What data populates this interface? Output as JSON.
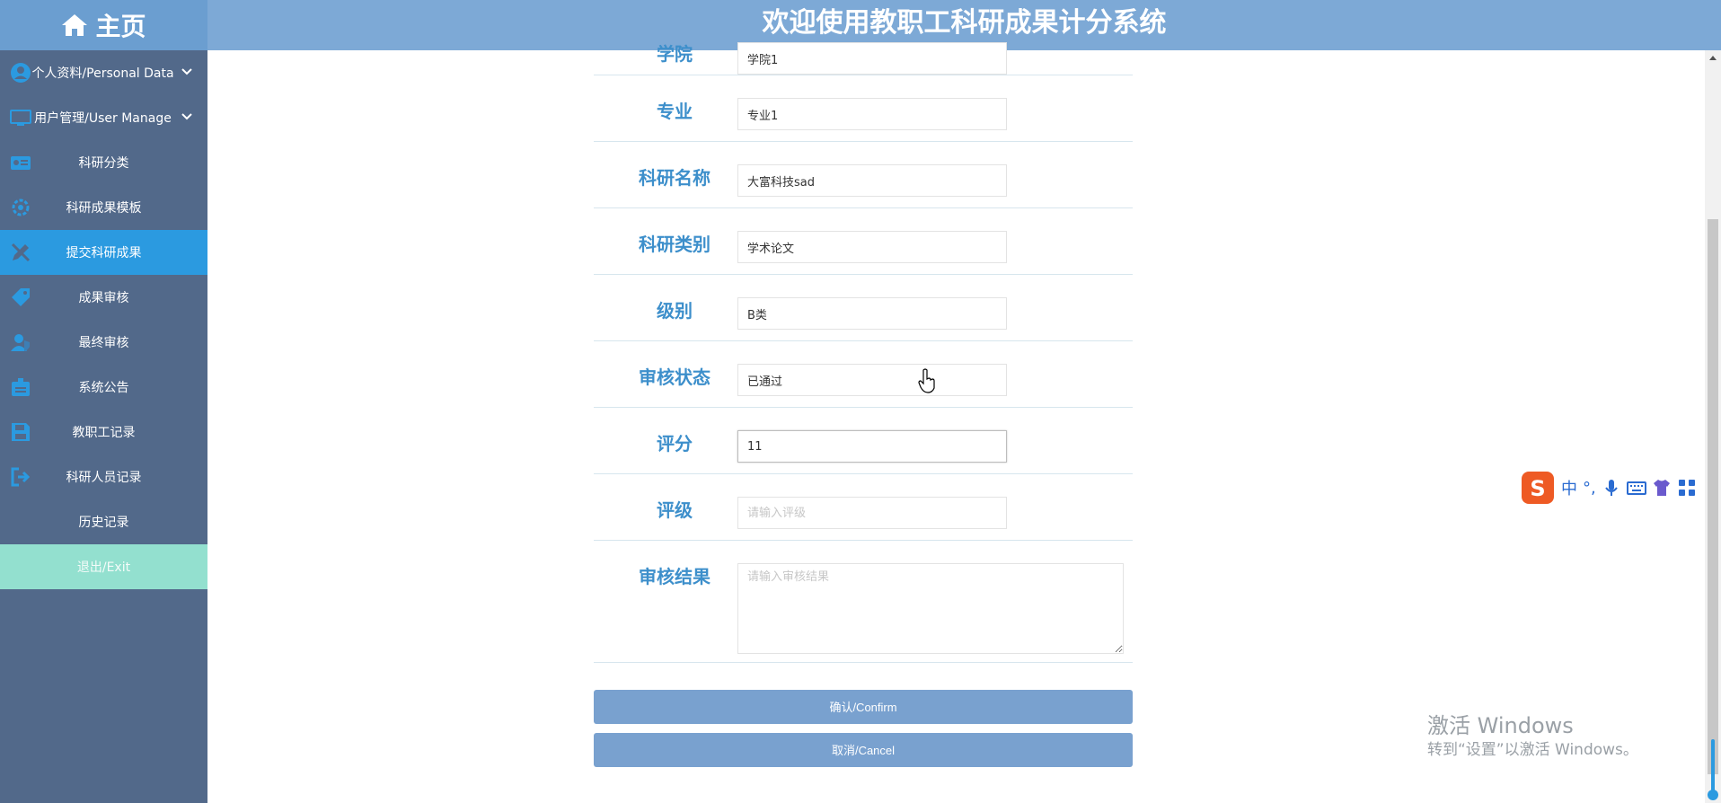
{
  "header": {
    "home_label": "主页",
    "title": "欢迎使用教职工科研成果计分系统"
  },
  "sidebar": {
    "items": [
      {
        "label": "个人资料/Personal Data",
        "icon": "user-circle-icon",
        "expandable": true
      },
      {
        "label": "用户管理/User Manage",
        "icon": "monitor-icon",
        "expandable": true
      },
      {
        "label": "科研分类",
        "icon": "id-card-icon"
      },
      {
        "label": "科研成果模板",
        "icon": "gear-icon"
      },
      {
        "label": "提交科研成果",
        "icon": "pencil-ruler-icon",
        "active": true
      },
      {
        "label": "成果审核",
        "icon": "tags-icon"
      },
      {
        "label": "最终审核",
        "icon": "user-shield-icon"
      },
      {
        "label": "系统公告",
        "icon": "id-badge-icon"
      },
      {
        "label": "教职工记录",
        "icon": "save-icon"
      },
      {
        "label": "科研人员记录",
        "icon": "sign-out-icon"
      },
      {
        "label": "历史记录",
        "icon": ""
      },
      {
        "label": "退出/Exit",
        "icon": ""
      }
    ]
  },
  "form": {
    "fields": [
      {
        "label": "学院",
        "value": "学院1"
      },
      {
        "label": "专业",
        "value": "专业1"
      },
      {
        "label": "科研名称",
        "value": "大富科技sad"
      },
      {
        "label": "科研类别",
        "value": "学术论文"
      },
      {
        "label": "级别",
        "value": "B类"
      },
      {
        "label": "审核状态",
        "value": "已通过"
      },
      {
        "label": "评分",
        "value": "11"
      },
      {
        "label": "评级",
        "value": "",
        "placeholder": "请输入评级"
      },
      {
        "label": "审核结果",
        "value": "",
        "placeholder": "请输入审核结果"
      }
    ],
    "confirm_label": "确认/Confirm",
    "cancel_label": "取消/Cancel"
  },
  "ime": {
    "mode_label": "中",
    "punct_label": "°,"
  },
  "watermark": {
    "line1": "激活 Windows",
    "line2": "转到“设置”以激活 Windows。"
  },
  "colors": {
    "topbar": "#7da9d6",
    "sidebar": "#52698a",
    "active_item": "#2b9ae0",
    "exit_item": "#93e0cf",
    "label_blue": "#3d8fcb",
    "button": "#79a1cf"
  }
}
